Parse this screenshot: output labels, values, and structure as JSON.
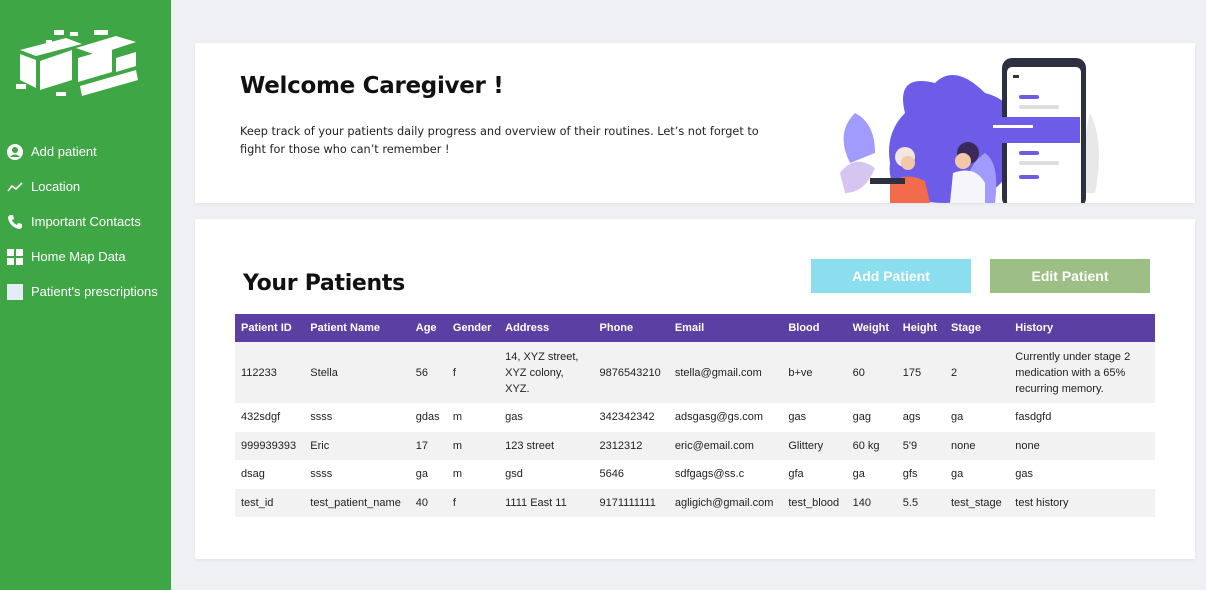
{
  "sidebar": {
    "items": [
      {
        "label": "Add patient",
        "icon": "user-circle-icon"
      },
      {
        "label": "Location",
        "icon": "trend-line-icon"
      },
      {
        "label": "Important Contacts",
        "icon": "phone-icon"
      },
      {
        "label": "Home Map Data",
        "icon": "grid-icon"
      },
      {
        "label": "Patient's prescriptions",
        "icon": "square-icon"
      }
    ]
  },
  "welcome": {
    "title": "Welcome Caregiver !",
    "text": "Keep track of your patients daily progress and overview of their routines. Let’s not forget to fight for those who can’t remember !"
  },
  "patients": {
    "title": "Your Patients",
    "add_label": "Add Patient",
    "edit_label": "Edit Patient",
    "columns": [
      "Patient ID",
      "Patient Name",
      "Age",
      "Gender",
      "Address",
      "Phone",
      "Email",
      "Blood",
      "Weight",
      "Height",
      "Stage",
      "History"
    ],
    "rows": [
      [
        "112233",
        "Stella",
        "56",
        "f",
        "14, XYZ street, XYZ colony, XYZ.",
        "9876543210",
        "stella@gmail.com",
        "b+ve",
        "60",
        "175",
        "2",
        "Currently under stage 2 medication with a 65% recurring memory."
      ],
      [
        "432sdgf",
        "ssss",
        "gdas",
        "m",
        "gas",
        "342342342",
        "adsgasg@gs.com",
        "gas",
        "gag",
        "ags",
        "ga",
        "fasdgfd"
      ],
      [
        "999939393",
        "Eric",
        "17",
        "m",
        "123 street",
        "2312312",
        "eric@email.com",
        "Glittery",
        "60 kg",
        "5'9",
        "none",
        "none"
      ],
      [
        "dsag",
        "ssss",
        "ga",
        "m",
        "gsd",
        "5646",
        "sdfgags@ss.c",
        "gfa",
        "ga",
        "gfs",
        "ga",
        "gas"
      ],
      [
        "test_id",
        "test_patient_name",
        "40",
        "f",
        "1111 East 11",
        "9171111111",
        "agligich@gmail.com",
        "test_blood",
        "140",
        "5.5",
        "test_stage",
        "test history"
      ]
    ]
  },
  "colors": {
    "sidebar": "#3fa646",
    "table_header": "#5c3fa3",
    "add_button": "#8adeed",
    "edit_button": "#9dbf85"
  }
}
